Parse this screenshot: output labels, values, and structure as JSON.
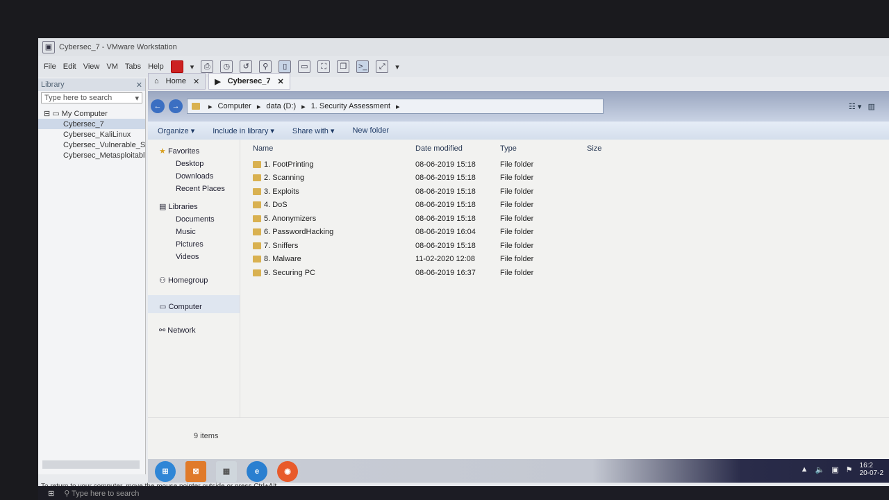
{
  "window": {
    "title": "Cybersec_7 - VMware Workstation"
  },
  "menu": [
    "File",
    "Edit",
    "View",
    "VM",
    "Tabs",
    "Help"
  ],
  "toolbar_icons": [
    "power-icon",
    "send-keys-icon",
    "snapshot-icon",
    "revert-snapshot-icon",
    "snapshot-manager-icon",
    "library-view-icon",
    "thumbnail-view-icon",
    "fullscreen-icon",
    "unity-icon",
    "console-icon",
    "stretch-icon"
  ],
  "library": {
    "title": "Library",
    "search_placeholder": "Type here to search",
    "root": "My Computer",
    "items": [
      "Cybersec_7",
      "Cybersec_KaliLinux",
      "Cybersec_Vulnerable_Se",
      "Cybersec_Metasploitabl"
    ],
    "selected": 0
  },
  "tabs": [
    {
      "label": "Home"
    },
    {
      "label": "Cybersec_7"
    }
  ],
  "explorer": {
    "breadcrumb": [
      "Computer",
      "data (D:)",
      "1. Security Assessment"
    ],
    "commands": [
      "Organize",
      "Include in library",
      "Share with",
      "New folder"
    ],
    "nav": {
      "favorites": "Favorites",
      "fav_items": [
        "Desktop",
        "Downloads",
        "Recent Places"
      ],
      "libraries": "Libraries",
      "lib_items": [
        "Documents",
        "Music",
        "Pictures",
        "Videos"
      ],
      "homegroup": "Homegroup",
      "computer": "Computer",
      "network": "Network"
    },
    "columns": [
      "Name",
      "Date modified",
      "Type",
      "Size"
    ],
    "rows": [
      {
        "name": "1. FootPrinting",
        "date": "08-06-2019 15:18",
        "type": "File folder"
      },
      {
        "name": "2. Scanning",
        "date": "08-06-2019 15:18",
        "type": "File folder"
      },
      {
        "name": "3. Exploits",
        "date": "08-06-2019 15:18",
        "type": "File folder"
      },
      {
        "name": "4. DoS",
        "date": "08-06-2019 15:18",
        "type": "File folder"
      },
      {
        "name": "5. Anonymizers",
        "date": "08-06-2019 15:18",
        "type": "File folder"
      },
      {
        "name": "6. PasswordHacking",
        "date": "08-06-2019 16:04",
        "type": "File folder"
      },
      {
        "name": "7. Sniffers",
        "date": "08-06-2019 15:18",
        "type": "File folder"
      },
      {
        "name": "8. Malware",
        "date": "11-02-2020 12:08",
        "type": "File folder"
      },
      {
        "name": "9. Securing PC",
        "date": "08-06-2019 16:37",
        "type": "File folder"
      }
    ],
    "status": "9 items"
  },
  "guest_taskbar": {
    "apps": [
      "start-orb-icon",
      "xampp-icon",
      "control-panel-icon",
      "internet-explorer-icon",
      "firefox-icon"
    ],
    "clock": "16:2",
    "date": "20-07-2"
  },
  "hint": "To return to your computer, move the mouse pointer outside or press Ctrl+Alt.",
  "host": {
    "search_placeholder": "Type here to search"
  }
}
